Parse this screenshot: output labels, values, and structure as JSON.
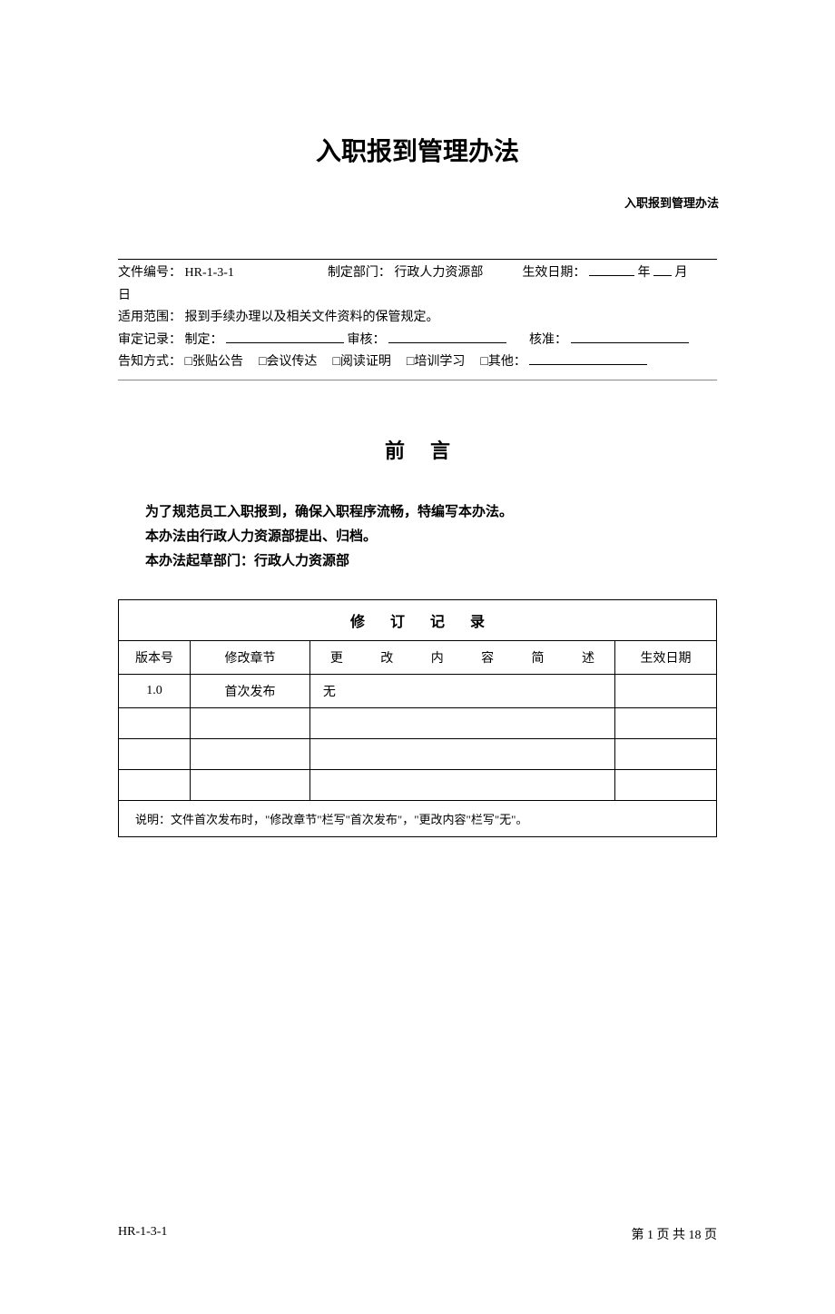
{
  "header": {
    "label": "入职报到管理办法"
  },
  "title": "入职报到管理办法",
  "meta": {
    "doc_no_label": "文件编号：",
    "doc_no_value": "HR-1-3-1",
    "dept_label": "制定部门：",
    "dept_value": "行政人力资源部",
    "effective_label": "生效日期：",
    "year_suffix": "年",
    "month_suffix": "月",
    "day_line": "日",
    "scope_label": "适用范围：",
    "scope_value": "报到手续办理以及相关文件资料的保管规定。",
    "approval_label": "审定记录：",
    "make_label": "制定：",
    "review_label": "审核：",
    "approve_label": "核准：",
    "notify_label": "告知方式：",
    "opt1": "□张贴公告",
    "opt2": "□会议传达",
    "opt3": "□阅读证明",
    "opt4": "□培训学习",
    "opt5": "□其他："
  },
  "preface": {
    "title": "前言",
    "p1": "为了规范员工入职报到，确保入职程序流畅，特编写本办法。",
    "p2": "本办法由行政人力资源部提出、归档。",
    "p3": "本办法起草部门：行政人力资源部"
  },
  "revision": {
    "title": "修订记录",
    "col1": "版本号",
    "col2": "修改章节",
    "col3": "更改内容简述",
    "col4": "生效日期",
    "rows": [
      {
        "ver": "1.0",
        "chapter": "首次发布",
        "desc": "无",
        "date": ""
      },
      {
        "ver": "",
        "chapter": "",
        "desc": "",
        "date": ""
      },
      {
        "ver": "",
        "chapter": "",
        "desc": "",
        "date": ""
      },
      {
        "ver": "",
        "chapter": "",
        "desc": "",
        "date": ""
      }
    ],
    "note": "说明：文件首次发布时，\"修改章节\"栏写\"首次发布\"，\"更改内容\"栏写\"无\"。"
  },
  "footer": {
    "left": "HR-1-3-1",
    "right": "第 1 页 共 18 页"
  }
}
